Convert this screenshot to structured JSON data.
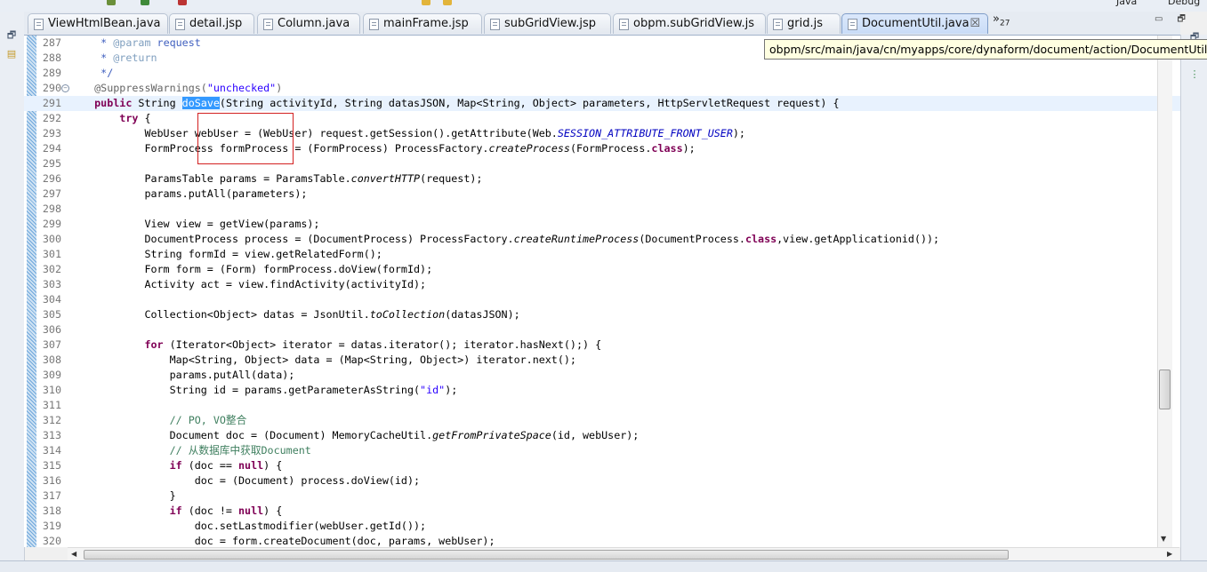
{
  "toolbar": {
    "perspective_java": "Java",
    "perspective_debug": "Debug"
  },
  "tabs": [
    {
      "label": "ViewHtmlBean.java",
      "active": false
    },
    {
      "label": "detail.jsp",
      "active": false
    },
    {
      "label": "Column.java",
      "active": false
    },
    {
      "label": "mainFrame.jsp",
      "active": false
    },
    {
      "label": "subGridView.jsp",
      "active": false
    },
    {
      "label": "obpm.subGridView.js",
      "active": false
    },
    {
      "label": "grid.js",
      "active": false
    },
    {
      "label": "DocumentUtil.java",
      "active": true
    }
  ],
  "tab_overflow": {
    "symbol": "»",
    "count": "27"
  },
  "tab_close_glyph": "☒",
  "tooltip": "obpm/src/main/java/cn/myapps/core/dynaform/document/action/DocumentUtil.java",
  "editor": {
    "current_line": 291,
    "selected_text": "doSave",
    "lines": [
      {
        "n": "287",
        "segs": [
          [
            "jd",
            "     * "
          ],
          [
            "jt",
            "@param"
          ],
          [
            "jd",
            " request"
          ]
        ]
      },
      {
        "n": "288",
        "segs": [
          [
            "jd",
            "     * "
          ],
          [
            "jt",
            "@return"
          ]
        ]
      },
      {
        "n": "289",
        "segs": [
          [
            "jd",
            "     */"
          ]
        ]
      },
      {
        "n": "290",
        "fold": true,
        "segs": [
          [
            "an",
            "    @SuppressWarnings("
          ],
          [
            "str",
            "\"unchecked\""
          ],
          [
            "an",
            ")"
          ]
        ]
      },
      {
        "n": "291",
        "segs": [
          [
            "kw",
            "    public"
          ],
          [
            "",
            " String "
          ],
          [
            "sel",
            "doSave"
          ],
          [
            "",
            "("
          ],
          [
            "",
            "String activityId, String datasJSON, Map<String, Object> parameters, HttpServletRequest request) {"
          ]
        ]
      },
      {
        "n": "292",
        "segs": [
          [
            "kw",
            "        try"
          ],
          [
            "",
            " {"
          ]
        ]
      },
      {
        "n": "293",
        "segs": [
          [
            "",
            "            WebUser webUser = (WebUser) request.getSession().getAttribute(Web."
          ],
          [
            "st",
            "SESSION_ATTRIBUTE_FRONT_USER"
          ],
          [
            "",
            ");"
          ]
        ]
      },
      {
        "n": "294",
        "segs": [
          [
            "",
            "            FormProcess formProcess = (FormProcess) ProcessFactory."
          ],
          [
            "it",
            "createProcess"
          ],
          [
            "",
            "(FormProcess."
          ],
          [
            "kw",
            "class"
          ],
          [
            "",
            ");"
          ]
        ]
      },
      {
        "n": "295",
        "segs": []
      },
      {
        "n": "296",
        "segs": [
          [
            "",
            "            ParamsTable params = ParamsTable."
          ],
          [
            "it",
            "convertHTTP"
          ],
          [
            "",
            "(request);"
          ]
        ]
      },
      {
        "n": "297",
        "segs": [
          [
            "",
            "            params.putAll(parameters);"
          ]
        ]
      },
      {
        "n": "298",
        "segs": []
      },
      {
        "n": "299",
        "segs": [
          [
            "",
            "            View view = getView(params);"
          ]
        ]
      },
      {
        "n": "300",
        "segs": [
          [
            "",
            "            DocumentProcess process = (DocumentProcess) ProcessFactory."
          ],
          [
            "it",
            "createRuntimeProcess"
          ],
          [
            "",
            "(DocumentProcess."
          ],
          [
            "kw",
            "class"
          ],
          [
            "",
            ",view.getApplicationid());"
          ]
        ]
      },
      {
        "n": "301",
        "segs": [
          [
            "",
            "            String formId = view.getRelatedForm();"
          ]
        ]
      },
      {
        "n": "302",
        "segs": [
          [
            "",
            "            Form form = (Form) formProcess.doView(formId);"
          ]
        ]
      },
      {
        "n": "303",
        "segs": [
          [
            "",
            "            Activity act = view.findActivity(activityId);"
          ]
        ]
      },
      {
        "n": "304",
        "segs": []
      },
      {
        "n": "305",
        "segs": [
          [
            "",
            "            Collection<Object> datas = JsonUtil."
          ],
          [
            "it",
            "toCollection"
          ],
          [
            "",
            "(datasJSON);"
          ]
        ]
      },
      {
        "n": "306",
        "segs": []
      },
      {
        "n": "307",
        "segs": [
          [
            "kw",
            "            for"
          ],
          [
            "",
            " (Iterator<Object> iterator = datas.iterator(); iterator.hasNext();) {"
          ]
        ]
      },
      {
        "n": "308",
        "segs": [
          [
            "",
            "                Map<String, Object> data = (Map<String, Object>) iterator.next();"
          ]
        ]
      },
      {
        "n": "309",
        "segs": [
          [
            "",
            "                params.putAll(data);"
          ]
        ]
      },
      {
        "n": "310",
        "segs": [
          [
            "",
            "                String id = params.getParameterAsString("
          ],
          [
            "str",
            "\"id\""
          ],
          [
            "",
            ");"
          ]
        ]
      },
      {
        "n": "311",
        "segs": []
      },
      {
        "n": "312",
        "segs": [
          [
            "cm",
            "                // PO, VO整合"
          ]
        ]
      },
      {
        "n": "313",
        "segs": [
          [
            "",
            "                Document doc = (Document) MemoryCacheUtil."
          ],
          [
            "it",
            "getFromPrivateSpace"
          ],
          [
            "",
            "(id, webUser);"
          ]
        ]
      },
      {
        "n": "314",
        "segs": [
          [
            "cm",
            "                // 从数据库中获取Document"
          ]
        ]
      },
      {
        "n": "315",
        "segs": [
          [
            "kw",
            "                if"
          ],
          [
            "",
            " (doc == "
          ],
          [
            "kw",
            "null"
          ],
          [
            "",
            ") {"
          ]
        ]
      },
      {
        "n": "316",
        "segs": [
          [
            "",
            "                    doc = (Document) process.doView(id);"
          ]
        ]
      },
      {
        "n": "317",
        "segs": [
          [
            "",
            "                }"
          ]
        ]
      },
      {
        "n": "318",
        "segs": [
          [
            "kw",
            "                if"
          ],
          [
            "",
            " (doc != "
          ],
          [
            "kw",
            "null"
          ],
          [
            "",
            ") {"
          ]
        ]
      },
      {
        "n": "319",
        "segs": [
          [
            "",
            "                    doc.setLastmodifier(webUser.getId());"
          ]
        ]
      },
      {
        "n": "320",
        "segs": [
          [
            "",
            "                    doc = form.createDocument(doc, params, webUser);"
          ]
        ]
      }
    ]
  },
  "icons": {
    "left_restore": "restore-icon",
    "left_packages": "package-explorer-icon",
    "right_restore": "restore-icon",
    "right_outline": "outline-icon"
  }
}
